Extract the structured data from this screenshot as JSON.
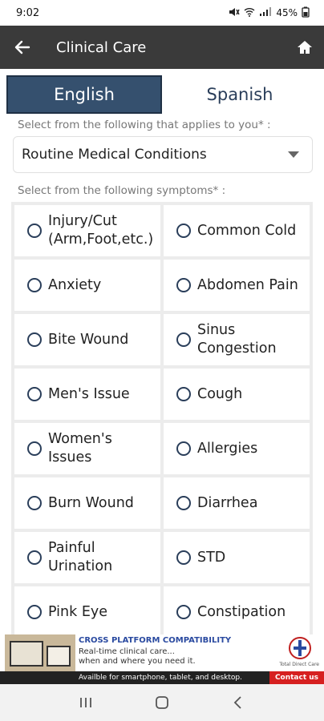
{
  "status_bar": {
    "time": "9:02",
    "battery": "45%"
  },
  "app_bar": {
    "title": "Clinical Care"
  },
  "tabs": [
    {
      "label": "English",
      "active": true
    },
    {
      "label": "Spanish",
      "active": false
    }
  ],
  "labels": {
    "select_condition": "Select from the following that applies to you* :",
    "select_symptoms": "Select from the following symptoms* :"
  },
  "condition_select": {
    "value": "Routine Medical Conditions"
  },
  "symptoms": [
    [
      "Injury/Cut",
      "(Arm,Foot,etc.)"
    ],
    [
      "Common Cold"
    ],
    [
      "Anxiety"
    ],
    [
      "Abdomen Pain"
    ],
    [
      "Bite Wound"
    ],
    [
      "Sinus",
      "Congestion"
    ],
    [
      "Men's Issue"
    ],
    [
      "Cough"
    ],
    [
      "Women's",
      "Issues"
    ],
    [
      "Allergies"
    ],
    [
      "Burn Wound"
    ],
    [
      "Diarrhea"
    ],
    [
      "Painful",
      "Urination"
    ],
    [
      "STD"
    ],
    [
      "Pink Eye"
    ],
    [
      "Constipation"
    ]
  ],
  "ad": {
    "headline": "CROSS PLATFORM COMPATIBILITY",
    "line1": "Real-time clinical care...",
    "line2": "when and where you need it.",
    "bottom": "Availble for smartphone, tablet, and desktop.",
    "contact": "Contact us",
    "logo_text": "Total Direct Care"
  },
  "colors": {
    "app_bar": "#3a3a3a",
    "tab_active": "#35506e",
    "accent": "#2a3e5a"
  }
}
